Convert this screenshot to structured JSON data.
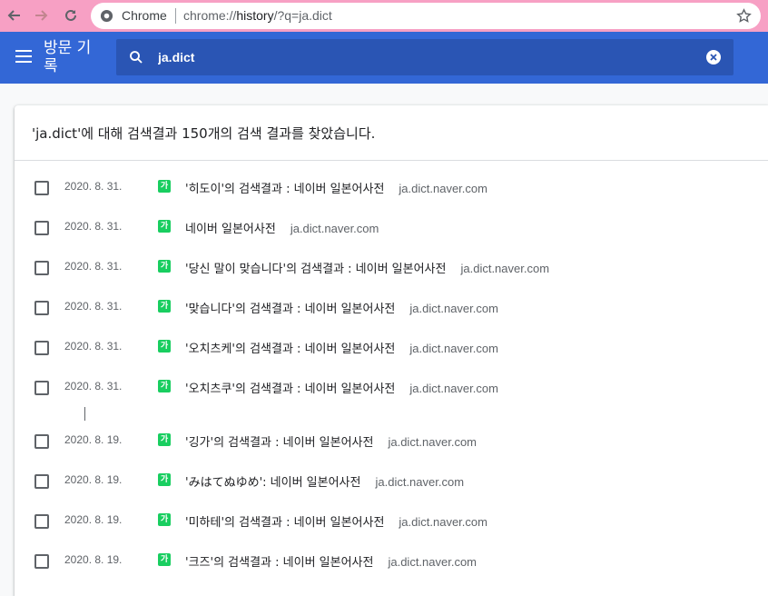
{
  "browser": {
    "site_chip": "Chrome",
    "url_scheme": "chrome://",
    "url_host": "history",
    "url_path": "/?q=ja.dict"
  },
  "header": {
    "title": "방문 기록",
    "search_value": "ja.dict"
  },
  "results": {
    "summary": "'ja.dict'에 대해 검색결과 150개의 검색 결과를 찾았습니다.",
    "favicon_text": "가",
    "items": [
      {
        "date": "2020. 8. 31.",
        "title": "'히도이'의 검색결과 : 네이버 일본어사전",
        "domain": "ja.dict.naver.com"
      },
      {
        "date": "2020. 8. 31.",
        "title": "네이버 일본어사전",
        "domain": "ja.dict.naver.com"
      },
      {
        "date": "2020. 8. 31.",
        "title": "'당신 말이 맞습니다'의 검색결과 : 네이버 일본어사전",
        "domain": "ja.dict.naver.com"
      },
      {
        "date": "2020. 8. 31.",
        "title": "'맞습니다'의 검색결과 : 네이버 일본어사전",
        "domain": "ja.dict.naver.com"
      },
      {
        "date": "2020. 8. 31.",
        "title": "'오치츠케'의 검색결과 : 네이버 일본어사전",
        "domain": "ja.dict.naver.com"
      },
      {
        "date": "2020. 8. 31.",
        "title": "'오치츠쿠'의 검색결과 : 네이버 일본어사전",
        "domain": "ja.dict.naver.com"
      },
      {
        "date": "2020. 8. 19.",
        "title": "'깅가'의 검색결과 : 네이버 일본어사전",
        "domain": "ja.dict.naver.com"
      },
      {
        "date": "2020. 8. 19.",
        "title": "'みはてぬゆめ': 네이버 일본어사전",
        "domain": "ja.dict.naver.com"
      },
      {
        "date": "2020. 8. 19.",
        "title": "'미하테'의 검색결과 : 네이버 일본어사전",
        "domain": "ja.dict.naver.com"
      },
      {
        "date": "2020. 8. 19.",
        "title": "'크즈'의 검색결과 : 네이버 일본어사전",
        "domain": "ja.dict.naver.com"
      }
    ]
  },
  "colors": {
    "browser_bar": "#f7a0c4",
    "header": "#3367d6",
    "search_box": "#2a55b4",
    "favicon": "#19ce60"
  },
  "icons": {
    "back": "back-arrow-icon",
    "forward": "forward-arrow-icon",
    "reload": "reload-icon",
    "site": "chrome-icon",
    "bookmark": "star-icon",
    "menu": "hamburger-menu-icon",
    "search": "search-icon",
    "clear": "clear-icon"
  }
}
